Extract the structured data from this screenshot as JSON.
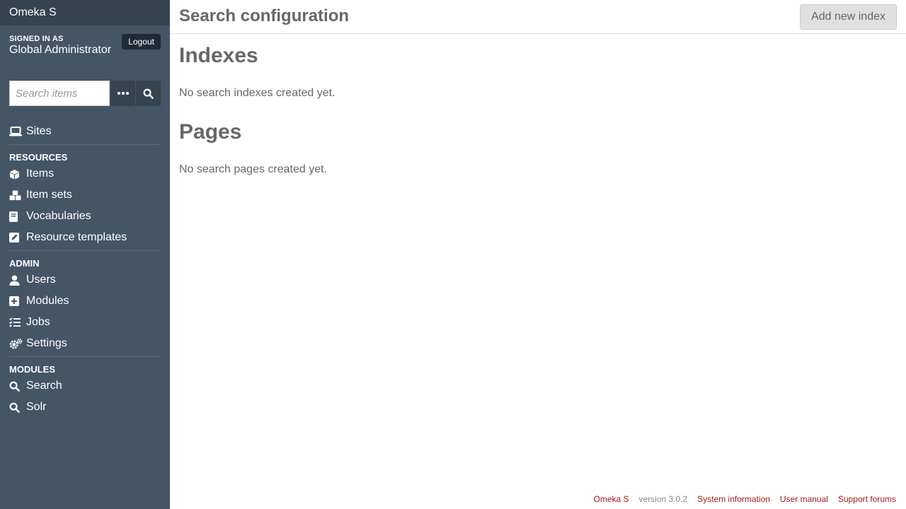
{
  "app": {
    "brand": "Omeka S"
  },
  "user": {
    "signed_in_label": "SIGNED IN AS",
    "name": "Global Administrator",
    "logout_label": "Logout"
  },
  "search": {
    "placeholder": "Search items"
  },
  "nav": {
    "sites": "Sites",
    "resources_heading": "RESOURCES",
    "resources": [
      "Items",
      "Item sets",
      "Vocabularies",
      "Resource templates"
    ],
    "admin_heading": "ADMIN",
    "admin": [
      "Users",
      "Modules",
      "Jobs",
      "Settings"
    ],
    "modules_heading": "MODULES",
    "modules": [
      "Search",
      "Solr"
    ]
  },
  "header": {
    "title": "Search configuration",
    "add_button": "Add new index"
  },
  "main": {
    "indexes_heading": "Indexes",
    "indexes_empty": "No search indexes created yet.",
    "pages_heading": "Pages",
    "pages_empty": "No search pages created yet."
  },
  "footer": {
    "brand_link": "Omeka S",
    "version": "version 3.0.2",
    "system_info": "System information",
    "user_manual": "User manual",
    "support_forums": "Support forums"
  },
  "colors": {
    "sidebar": "#445566",
    "sidebar_dark": "#364452",
    "link": "#a91919"
  }
}
